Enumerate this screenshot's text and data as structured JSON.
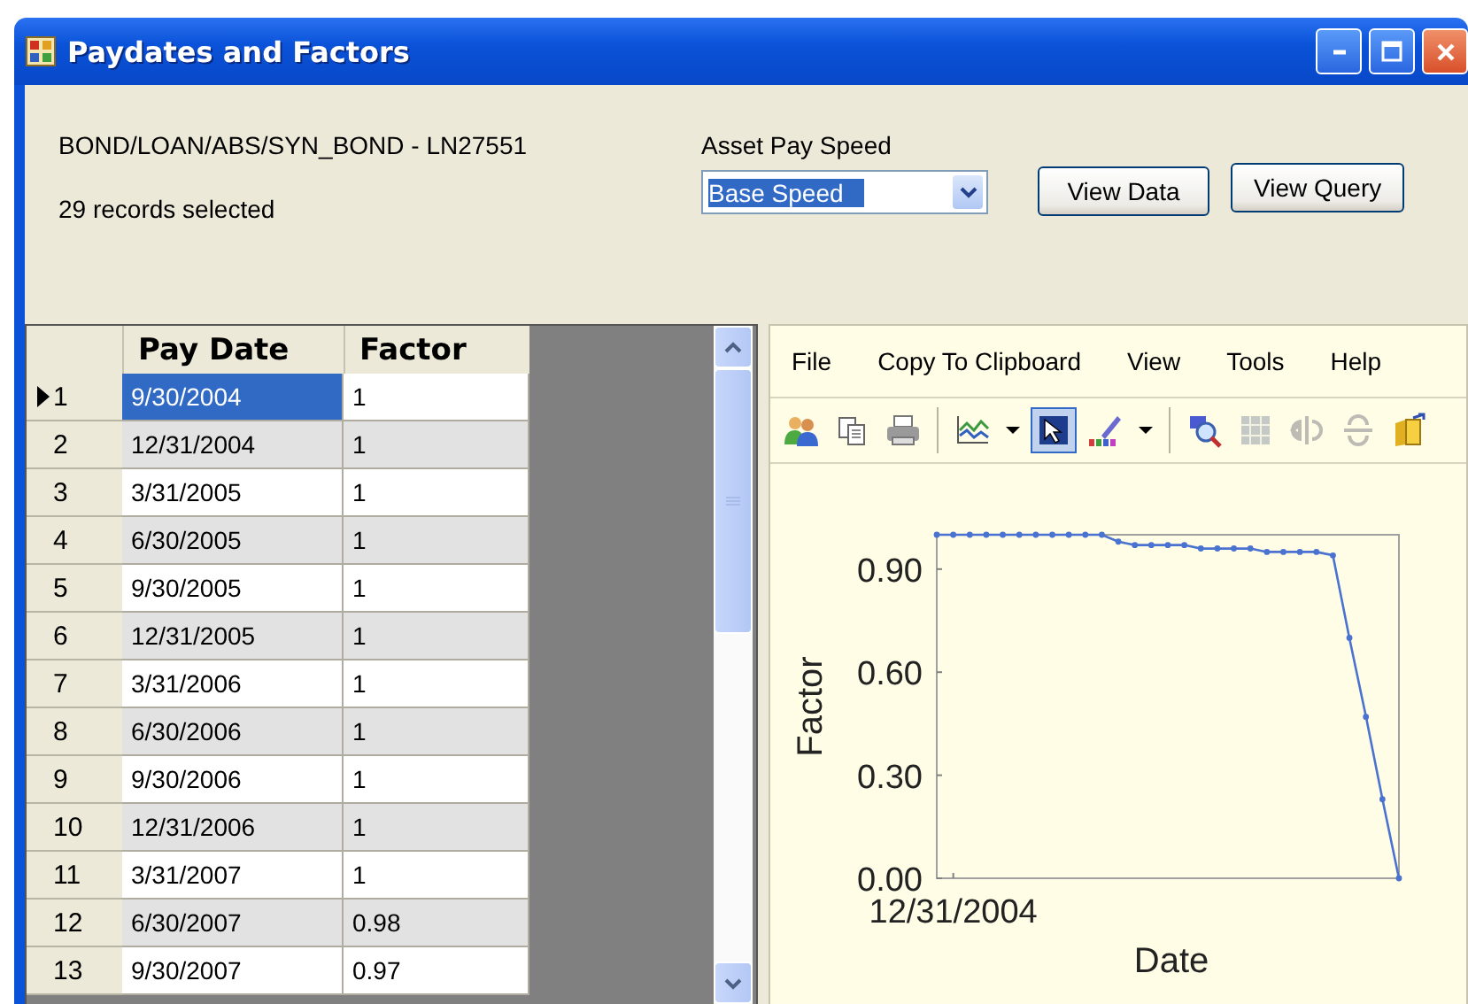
{
  "window": {
    "title": "Paydates and Factors"
  },
  "header": {
    "path_label": "BOND/LOAN/ABS/SYN_BOND - LN27551",
    "records_label": "29 records selected",
    "speed_label": "Asset Pay Speed",
    "speed_select": {
      "value": "Base Speed",
      "highlighted": true
    },
    "buttons": [
      "View Data",
      "View Query"
    ]
  },
  "table": {
    "columns": [
      "Pay Date",
      "Factor"
    ],
    "rows": [
      {
        "number": "1",
        "pay_date": "9/30/2004",
        "factor": "1",
        "current": true,
        "selected": true
      },
      {
        "number": "2",
        "pay_date": "12/31/2004",
        "factor": "1",
        "current": false,
        "selected": false
      },
      {
        "number": "3",
        "pay_date": "3/31/2005",
        "factor": "1",
        "current": false,
        "selected": false
      },
      {
        "number": "4",
        "pay_date": "6/30/2005",
        "factor": "1",
        "current": false,
        "selected": false
      },
      {
        "number": "5",
        "pay_date": "9/30/2005",
        "factor": "1",
        "current": false,
        "selected": false
      },
      {
        "number": "6",
        "pay_date": "12/31/2005",
        "factor": "1",
        "current": false,
        "selected": false
      },
      {
        "number": "7",
        "pay_date": "3/31/2006",
        "factor": "1",
        "current": false,
        "selected": false
      },
      {
        "number": "8",
        "pay_date": "6/30/2006",
        "factor": "1",
        "current": false,
        "selected": false
      },
      {
        "number": "9",
        "pay_date": "9/30/2006",
        "factor": "1",
        "current": false,
        "selected": false
      },
      {
        "number": "10",
        "pay_date": "12/31/2006",
        "factor": "1",
        "current": false,
        "selected": false
      },
      {
        "number": "11",
        "pay_date": "3/31/2007",
        "factor": "1",
        "current": false,
        "selected": false
      },
      {
        "number": "12",
        "pay_date": "6/30/2007",
        "factor": "0.98",
        "current": false,
        "selected": false
      },
      {
        "number": "13",
        "pay_date": "9/30/2007",
        "factor": "0.97",
        "current": false,
        "selected": false
      }
    ]
  },
  "chart_panel": {
    "menu": [
      "File",
      "Copy To Clipboard",
      "View",
      "Tools",
      "Help"
    ],
    "toolbar": [
      {
        "kind": "people",
        "selected": false,
        "disabled": false
      },
      {
        "kind": "copy",
        "selected": false,
        "disabled": false
      },
      {
        "kind": "print",
        "selected": false,
        "disabled": false
      },
      {
        "kind": "separator"
      },
      {
        "kind": "linechart",
        "selected": false,
        "disabled": false
      },
      {
        "kind": "caret",
        "selected": false,
        "disabled": false
      },
      {
        "kind": "pointer",
        "selected": true,
        "disabled": false
      },
      {
        "kind": "palette",
        "selected": false,
        "disabled": false
      },
      {
        "kind": "caret",
        "selected": false,
        "disabled": false
      },
      {
        "kind": "separator"
      },
      {
        "kind": "zoom",
        "selected": false,
        "disabled": false
      },
      {
        "kind": "grid",
        "selected": false,
        "disabled": true
      },
      {
        "kind": "rotate",
        "selected": false,
        "disabled": true
      },
      {
        "kind": "flip",
        "selected": false,
        "disabled": true
      },
      {
        "kind": "export",
        "selected": false,
        "disabled": false
      }
    ],
    "chart_data": {
      "type": "line",
      "xlabel": "Date",
      "ylabel": "Factor",
      "ylim": [
        0,
        1
      ],
      "annotations": [
        {
          "text": "12/31/2004"
        }
      ],
      "yticks": [
        {
          "value": 0,
          "label": "0.00"
        },
        {
          "value": 0.3,
          "label": "0.30"
        },
        {
          "value": 0.6,
          "label": "0.60"
        },
        {
          "value": 0.9,
          "label": "0.90"
        }
      ],
      "series": [
        {
          "marker": "circle",
          "color": "#4a72d0",
          "values": [
            1,
            1,
            1,
            1,
            1,
            1,
            1,
            1,
            1,
            1,
            1,
            0.98,
            0.97,
            0.97,
            0.97,
            0.97,
            0.96,
            0.96,
            0.96,
            0.96,
            0.95,
            0.95,
            0.95,
            0.95,
            0.94,
            0.7,
            0.47,
            0.23,
            0
          ]
        }
      ]
    }
  }
}
